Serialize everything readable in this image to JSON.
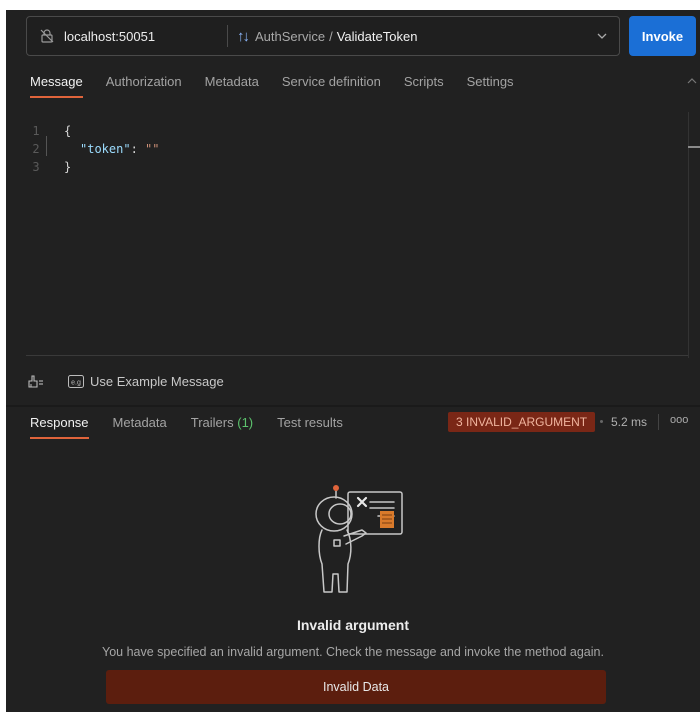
{
  "topbar": {
    "url": "localhost:50051",
    "service": "AuthService",
    "separator": "/",
    "method": "ValidateToken",
    "invoke_label": "Invoke"
  },
  "request_tabs": [
    {
      "label": "Message",
      "active": true
    },
    {
      "label": "Authorization",
      "active": false
    },
    {
      "label": "Metadata",
      "active": false
    },
    {
      "label": "Service definition",
      "active": false
    },
    {
      "label": "Scripts",
      "active": false
    },
    {
      "label": "Settings",
      "active": false
    }
  ],
  "editor": {
    "lines": [
      {
        "number": "1",
        "text": "{"
      },
      {
        "number": "2",
        "key": "\"token\"",
        "colon": ":",
        "value": "\"\""
      },
      {
        "number": "3",
        "text": "}"
      }
    ]
  },
  "toolbar": {
    "example_icon_text": "e.g",
    "use_example_label": "Use Example Message"
  },
  "response_tabs": [
    {
      "label": "Response",
      "active": true
    },
    {
      "label": "Metadata",
      "active": false
    },
    {
      "label": "Trailers",
      "count": "(1)",
      "active": false
    },
    {
      "label": "Test results",
      "active": false
    }
  ],
  "response_status": {
    "badge": "3 INVALID_ARGUMENT",
    "time": "5.2 ms",
    "more": "ooo"
  },
  "empty_state": {
    "title": "Invalid argument",
    "description": "You have specified an invalid argument. Check the message and invoke the method again.",
    "error_box": "Invalid Data"
  },
  "colors": {
    "accent": "#e0643b",
    "invoke": "#1b6fd6",
    "error_badge": "#7a2716",
    "error_box": "#5c1e0e",
    "count_green": "#5cc26d"
  }
}
